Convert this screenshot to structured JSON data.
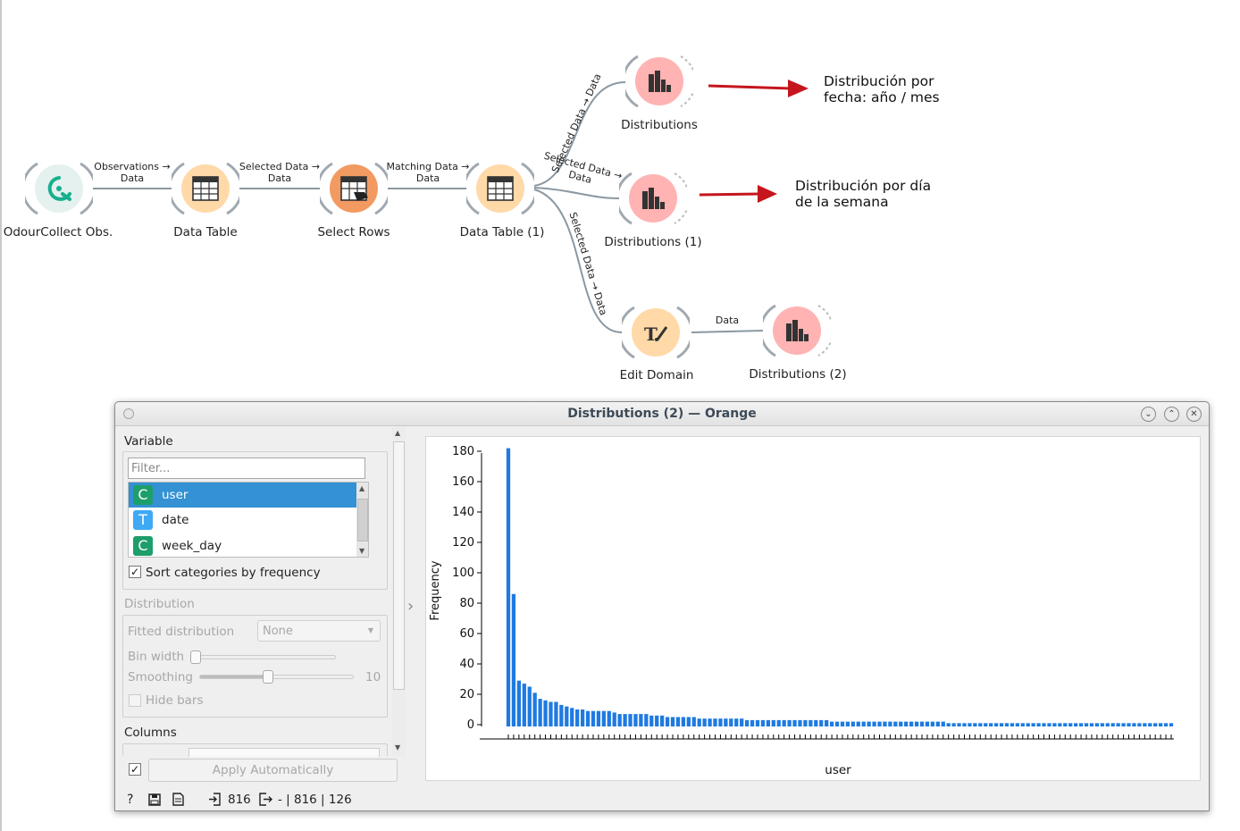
{
  "workflow": {
    "nodes": [
      {
        "id": "odour",
        "title": "OdourCollect Obs.",
        "icon": "odourcollect-logo-icon"
      },
      {
        "id": "dt",
        "title": "Data Table",
        "icon": "table-icon"
      },
      {
        "id": "sr",
        "title": "Select Rows",
        "icon": "select-rows-icon"
      },
      {
        "id": "dt1",
        "title": "Data Table (1)",
        "icon": "table-icon"
      },
      {
        "id": "dist",
        "title": "Distributions",
        "icon": "histogram-icon"
      },
      {
        "id": "dist1",
        "title": "Distributions (1)",
        "icon": "histogram-icon"
      },
      {
        "id": "ed",
        "title": "Edit Domain",
        "icon": "edit-domain-icon"
      },
      {
        "id": "dist2",
        "title": "Distributions (2)",
        "icon": "histogram-icon"
      }
    ],
    "links": {
      "l1": [
        "Observations →",
        "Data"
      ],
      "l2": [
        "Selected Data →",
        "Data"
      ],
      "l3": [
        "Matching Data →",
        "Data"
      ],
      "l4": "Selected Data → Data",
      "l5": [
        "Selected Data →",
        "Data"
      ],
      "l6": "Selected Data → Data",
      "l7": "Data"
    },
    "annotations": {
      "a1": [
        "Distribución por",
        "fecha: año / mes"
      ],
      "a2": [
        "Distribución por día",
        "de la semana"
      ]
    },
    "colors": {
      "data": "#ffe0b2",
      "process": "#f4a06a",
      "viz": "#ffb0b0",
      "link": "#8a98a2",
      "arrow": "#c4161c"
    }
  },
  "window": {
    "title": "Distributions (2) — Orange",
    "variable_box": {
      "title": "Variable",
      "filter_placeholder": "Filter...",
      "items": [
        {
          "name": "user",
          "type": "C",
          "color": "#1e9e6b",
          "selected": true
        },
        {
          "name": "date",
          "type": "T",
          "color": "#3fa9f5",
          "selected": false
        },
        {
          "name": "week_day",
          "type": "C",
          "color": "#1e9e6b",
          "selected": false
        }
      ],
      "sort_label": "Sort categories by frequency",
      "sort_checked": true
    },
    "distribution_box": {
      "title": "Distribution",
      "fitted_label": "Fitted distribution",
      "fitted_value": "None",
      "bin_width_label": "Bin width",
      "smoothing_label": "Smoothing",
      "smoothing_value": "10",
      "hide_bars_label": "Hide bars"
    },
    "columns_title": "Columns",
    "apply_label": "Apply Automatically",
    "apply_checked": true,
    "status": {
      "input_count": "816",
      "output_text": "- | 816 | 126"
    }
  },
  "chart_data": {
    "type": "bar",
    "xlabel": "user",
    "ylabel": "Frequency",
    "ylim": [
      0,
      180
    ],
    "yticks": [
      0,
      20,
      40,
      60,
      80,
      100,
      120,
      140,
      160,
      180
    ],
    "values": [
      182,
      86,
      29,
      27,
      25,
      21,
      17,
      16,
      15,
      15,
      13,
      12,
      11,
      10,
      10,
      9,
      9,
      9,
      9,
      9,
      8,
      7,
      7,
      7,
      7,
      7,
      7,
      6,
      6,
      6,
      5,
      5,
      5,
      5,
      5,
      5,
      4,
      4,
      4,
      4,
      4,
      4,
      4,
      4,
      4,
      3,
      3,
      3,
      3,
      3,
      3,
      3,
      3,
      3,
      3,
      3,
      3,
      3,
      3,
      3,
      3,
      2,
      2,
      2,
      2,
      2,
      2,
      2,
      2,
      2,
      2,
      2,
      2,
      2,
      2,
      2,
      2,
      2,
      2,
      2,
      2,
      2,
      2,
      1,
      1,
      1,
      1,
      1,
      1,
      1,
      1,
      1,
      1,
      1,
      1,
      1,
      1,
      1,
      1,
      1,
      1,
      1,
      1,
      1,
      1,
      1,
      1,
      1,
      1,
      1,
      1,
      1,
      1,
      1,
      1,
      1,
      1,
      1,
      1,
      1,
      1,
      1,
      1,
      1,
      1,
      1
    ],
    "bar_color": "#1f7ae0"
  }
}
